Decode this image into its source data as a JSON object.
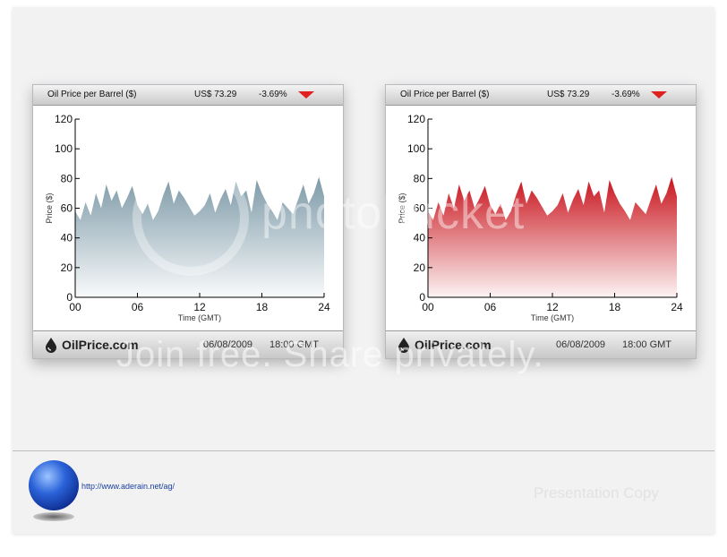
{
  "watermark": {
    "line1": "photobucket",
    "line2": "Join free. Share privately."
  },
  "footer": {
    "url": "http://www.aderain.net/ag/",
    "presentation": "Presentation Copy"
  },
  "panels": [
    {
      "title": "Oil Price per Barrel ($)",
      "price": "US$ 73.29",
      "change": "-3.69%",
      "logo": "OilPrice.com",
      "date": "06/08/2009",
      "time": "18:00 GMT",
      "fill_color": "#7d9aa8"
    },
    {
      "title": "Oil Price per Barrel ($)",
      "price": "US$ 73.29",
      "change": "-3.69%",
      "logo": "OilPrice.com",
      "date": "06/08/2009",
      "time": "18:00 GMT",
      "fill_color": "#c8141c"
    }
  ],
  "chart_data": [
    {
      "type": "area",
      "xlabel": "Time (GMT)",
      "ylabel": "Price ($)",
      "ylim": [
        0,
        120
      ],
      "xlim": [
        0,
        24
      ],
      "x_tick_labels": [
        "00",
        "06",
        "12",
        "18",
        "24"
      ],
      "y_tick_labels": [
        "0",
        "20",
        "40",
        "60",
        "80",
        "100",
        "120"
      ],
      "grid": false,
      "x": [
        0,
        0.5,
        1,
        1.5,
        2,
        2.5,
        3,
        3.5,
        4,
        4.5,
        5,
        5.5,
        6,
        6.5,
        7,
        7.5,
        8,
        8.5,
        9,
        9.5,
        10,
        10.5,
        11,
        11.5,
        12,
        12.5,
        13,
        13.5,
        14,
        14.5,
        15,
        15.5,
        16,
        16.5,
        17,
        17.5,
        18,
        18.5,
        19,
        19.5,
        20,
        20.5,
        21,
        21.5,
        22,
        22.5,
        23,
        23.5,
        24
      ],
      "values": [
        58,
        52,
        64,
        55,
        70,
        60,
        76,
        65,
        72,
        60,
        67,
        75,
        62,
        56,
        63,
        52,
        58,
        69,
        78,
        63,
        72,
        67,
        61,
        55,
        58,
        62,
        70,
        57,
        66,
        73,
        62,
        78,
        68,
        72,
        57,
        79,
        70,
        63,
        58,
        52,
        64,
        60,
        56,
        66,
        76,
        63,
        70,
        81,
        68
      ]
    },
    {
      "type": "area",
      "xlabel": "Time (GMT)",
      "ylabel": "Price ($)",
      "ylim": [
        0,
        120
      ],
      "xlim": [
        0,
        24
      ],
      "x_tick_labels": [
        "00",
        "06",
        "12",
        "18",
        "24"
      ],
      "y_tick_labels": [
        "0",
        "20",
        "40",
        "60",
        "80",
        "100",
        "120"
      ],
      "grid": false,
      "x": [
        0,
        0.5,
        1,
        1.5,
        2,
        2.5,
        3,
        3.5,
        4,
        4.5,
        5,
        5.5,
        6,
        6.5,
        7,
        7.5,
        8,
        8.5,
        9,
        9.5,
        10,
        10.5,
        11,
        11.5,
        12,
        12.5,
        13,
        13.5,
        14,
        14.5,
        15,
        15.5,
        16,
        16.5,
        17,
        17.5,
        18,
        18.5,
        19,
        19.5,
        20,
        20.5,
        21,
        21.5,
        22,
        22.5,
        23,
        23.5,
        24
      ],
      "values": [
        58,
        52,
        64,
        55,
        70,
        60,
        76,
        65,
        72,
        60,
        67,
        75,
        62,
        56,
        63,
        52,
        58,
        69,
        78,
        63,
        72,
        67,
        61,
        55,
        58,
        62,
        70,
        57,
        66,
        73,
        62,
        78,
        68,
        72,
        57,
        79,
        70,
        63,
        58,
        52,
        64,
        60,
        56,
        66,
        76,
        63,
        70,
        81,
        68
      ]
    }
  ]
}
